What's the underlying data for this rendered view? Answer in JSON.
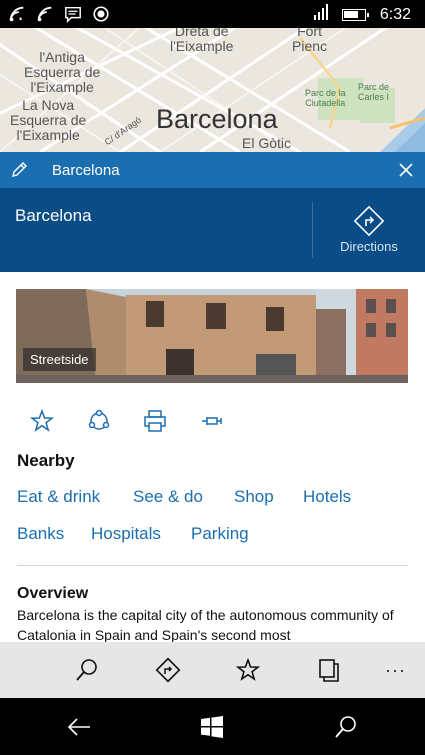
{
  "status_bar": {
    "time": "6:32",
    "icons": [
      "wifi-calling-icon",
      "wifi-icon",
      "message-icon",
      "record-icon",
      "signal-icon",
      "battery-icon"
    ]
  },
  "map": {
    "labels": {
      "dreta": "Dreta de\nl'Eixample",
      "fort_pienc": "Fort\nPienc",
      "antiga": "l'Antiga\nEsquerra de\nl'Eixample",
      "nova": "La Nova\nEsquerra de\nl'Eixample",
      "city": "Barcelona",
      "gotic": "El Gòtic",
      "parc_ciutadella": "Parc de la\nCiutadella",
      "parc_carles": "Parc de\nCarles I",
      "arago": "C/ d'Aragó"
    }
  },
  "title_strip": {
    "title": "Barcelona"
  },
  "header": {
    "place_name": "Barcelona",
    "directions_label": "Directions"
  },
  "streetside": {
    "label": "Streetside"
  },
  "actions": [
    "favorite-icon",
    "share-icon",
    "print-icon",
    "pin-icon"
  ],
  "nearby": {
    "title": "Nearby",
    "links": [
      "Eat & drink",
      "See & do",
      "Shop",
      "Hotels",
      "Banks",
      "Hospitals",
      "Parking"
    ]
  },
  "overview": {
    "title": "Overview",
    "text": "Barcelona is the capital city of the autonomous community of Catalonia in Spain and Spain's second most"
  },
  "colors": {
    "accent": "#1b6eaf",
    "header_bg": "#0a4c86",
    "app_bar_bg": "#e6e6e6"
  }
}
